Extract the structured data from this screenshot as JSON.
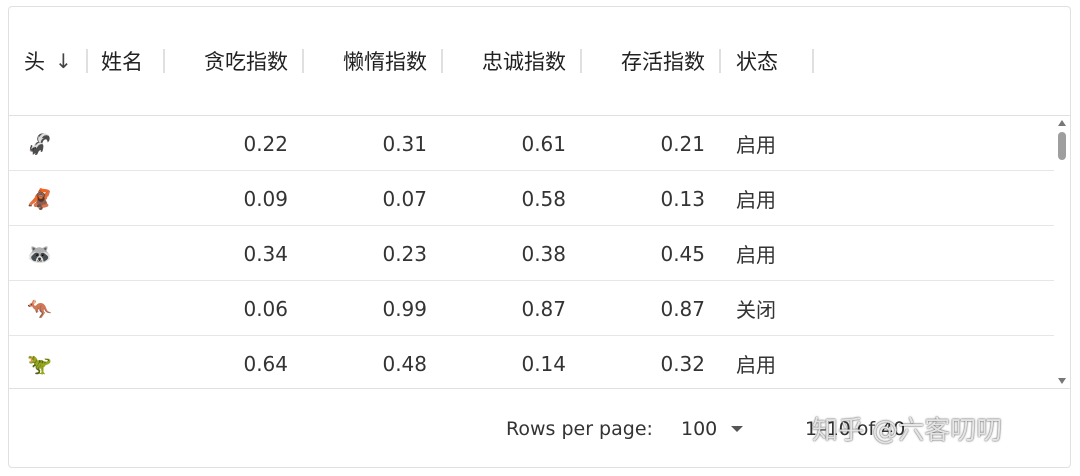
{
  "columns": {
    "avatar": "头",
    "name": "姓名",
    "greed": "贪吃指数",
    "laziness": "懒惰指数",
    "loyalty": "忠诚指数",
    "survival": "存活指数",
    "status": "状态",
    "sort_icon": "↓"
  },
  "rows": [
    {
      "icon": "🦨",
      "icon_name": "skunk-icon",
      "name": "",
      "greed": "0.22",
      "laziness": "0.31",
      "loyalty": "0.61",
      "survival": "0.21",
      "status": "启用"
    },
    {
      "icon": "🦧",
      "icon_name": "orangutan-icon",
      "name": "",
      "greed": "0.09",
      "laziness": "0.07",
      "loyalty": "0.58",
      "survival": "0.13",
      "status": "启用"
    },
    {
      "icon": "🦝",
      "icon_name": "raccoon-icon",
      "name": "",
      "greed": "0.34",
      "laziness": "0.23",
      "loyalty": "0.38",
      "survival": "0.45",
      "status": "启用"
    },
    {
      "icon": "🦘",
      "icon_name": "kangaroo-icon",
      "name": "",
      "greed": "0.06",
      "laziness": "0.99",
      "loyalty": "0.87",
      "survival": "0.87",
      "status": "关闭"
    },
    {
      "icon": "🦖",
      "icon_name": "t-rex-icon",
      "name": "",
      "greed": "0.64",
      "laziness": "0.48",
      "loyalty": "0.14",
      "survival": "0.32",
      "status": "启用"
    }
  ],
  "footer": {
    "rows_per_page_label": "Rows per page:",
    "rows_per_page_value": "100",
    "range_text": "1–10 of 40"
  },
  "watermark": "知乎 @六客叨叨"
}
